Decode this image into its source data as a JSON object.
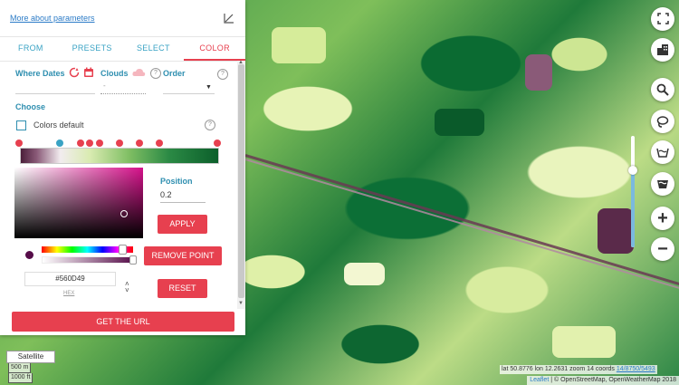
{
  "panel": {
    "more_link": "More about parameters",
    "tabs": [
      {
        "label": "FROM"
      },
      {
        "label": "PRESETS"
      },
      {
        "label": "SELECT"
      },
      {
        "label": "COLOR",
        "active": true
      }
    ],
    "filters": {
      "where_dates": "Where Dates",
      "clouds": "Clouds",
      "clouds_value": "-",
      "order": "Order"
    },
    "choose": "Choose",
    "colors_default": "Colors default",
    "position_label": "Position",
    "position_value": "0.2",
    "apply": "APPLY",
    "remove_point": "REMOVE POINT",
    "reset": "RESET",
    "hex_value": "#560D49",
    "hex_label": "HEX",
    "get_url": "GET THE URL",
    "selected_color": "#560d49",
    "accent_color": "#e7404f",
    "tab_color": "#3aa3c4"
  },
  "map": {
    "satellite": "Satellite",
    "scale_metric": "500 m",
    "scale_imperial": "1000 ft",
    "coords_text": "lat 50.8776 lon 12.2631 zoom 14  coords ",
    "coords_link": "14/8750/5493",
    "attribution_leaflet": "Leaflet",
    "attribution_rest": " | © OpenStreetMap, OpenWeatherMap 2018",
    "zoom_in": "+",
    "zoom_out": "−",
    "zoom_slider_level": 0.7
  }
}
